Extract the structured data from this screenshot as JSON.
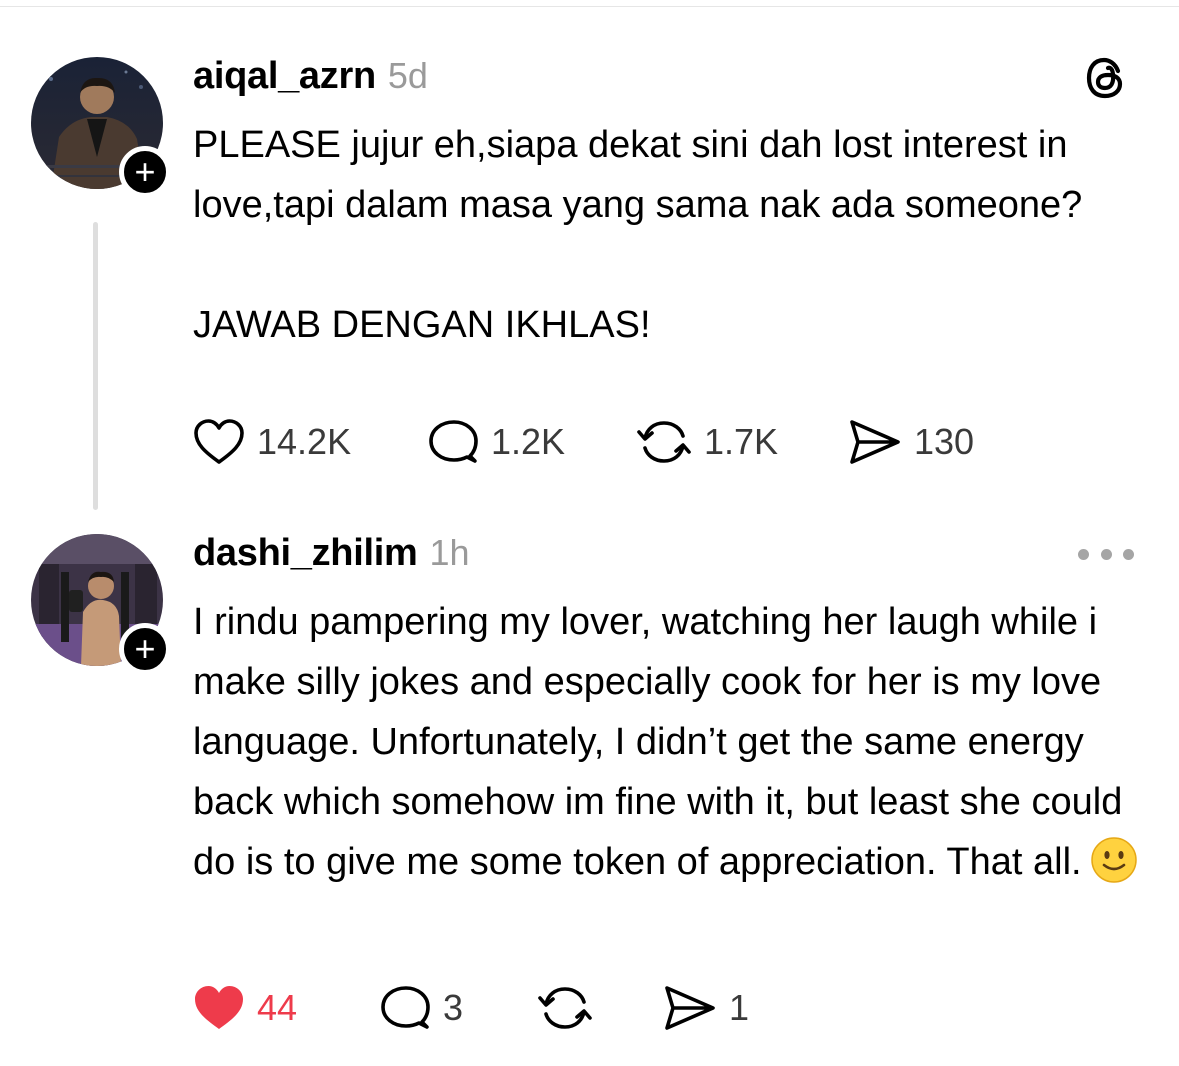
{
  "posts": [
    {
      "username": "aiqal_azrn",
      "time": "5d",
      "paragraphs": [
        "PLEASE jujur eh,siapa dekat sini dah lost interest in love,tapi dalam masa yang sama nak ada someone?",
        "JAWAB DENGAN IKHLAS!"
      ],
      "likes": "14.2K",
      "replies": "1.2K",
      "reposts": "1.7K",
      "shares": "130",
      "liked": false,
      "header_icon": "threads-logo-icon"
    },
    {
      "username": "dashi_zhilim",
      "time": "1h",
      "text": "I rindu pampering my lover, watching her laugh while i make silly jokes and especially cook for her is my love language. Unfortunately, I didn’t get the same energy back which somehow im fine with it, but least she could do is to give me some token of appreciation. That all.",
      "emoji": "slightly-smiling-face",
      "likes": "44",
      "replies": "3",
      "reposts": "",
      "shares": "1",
      "liked": true,
      "like_color": "#ee3b4b",
      "header_icon": "more-options-icon"
    }
  ],
  "follow_badge": "+"
}
